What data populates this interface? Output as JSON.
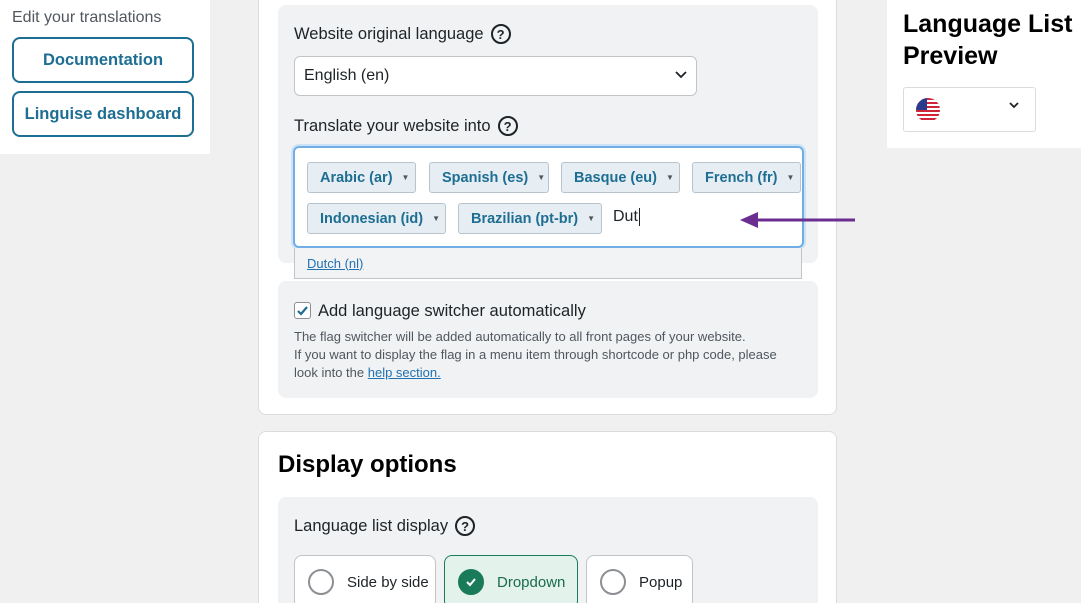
{
  "sidebar": {
    "title": "Edit your translations",
    "documentation_label": "Documentation",
    "dashboard_label": "Linguise dashboard"
  },
  "preview": {
    "title": "Language List Preview",
    "flag_icon": "us-flag-icon"
  },
  "languages": {
    "original_label": "Website original language",
    "original_value": "English (en)",
    "translate_label": "Translate your website into",
    "selected_tags": [
      "Arabic (ar)",
      "Spanish (es)",
      "Basque (eu)",
      "French (fr)",
      "Indonesian (id)",
      "Brazilian (pt-br)"
    ],
    "search_text": "Dut",
    "suggestion": "Dutch (nl)"
  },
  "switcher": {
    "label": "Add language switcher automatically",
    "checked": true,
    "desc_line1": "The flag switcher will be added automatically to all front pages of your website.",
    "desc_line2": "If you want to display the flag in a menu item through shortcode or php code, please look into the",
    "help_link": "help section."
  },
  "display": {
    "title": "Display options",
    "list_label": "Language list display",
    "options": [
      "Side by side",
      "Dropdown",
      "Popup"
    ],
    "selected": "Dropdown"
  },
  "colors": {
    "accent": "#1e6e93",
    "focus": "#72aee6",
    "selected_green": "#1a7b5a",
    "arrow": "#6b2d8f"
  }
}
